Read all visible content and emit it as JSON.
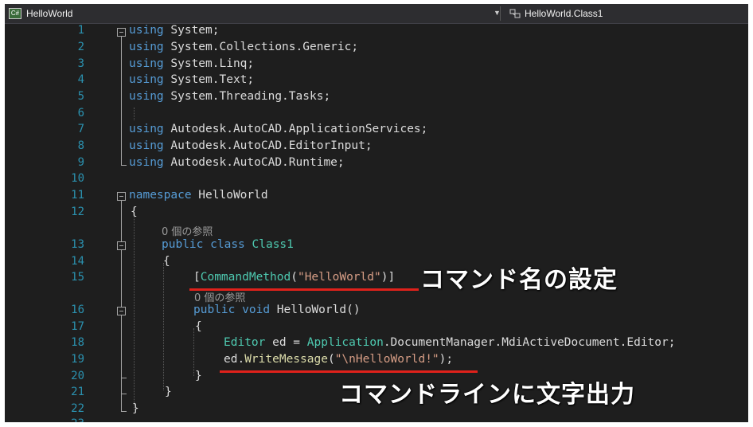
{
  "window": {
    "project_name": "HelloWorld",
    "project_badge": "C#",
    "member_crumb": "HelloWorld.Class1"
  },
  "colors": {
    "keyword": "#569cd6",
    "type": "#4ec9b0",
    "string": "#d69d85",
    "line_number": "#2b91af",
    "annotation_underline": "#e0211b"
  },
  "line_numbers": [
    "1",
    "2",
    "3",
    "4",
    "5",
    "6",
    "7",
    "8",
    "9",
    "10",
    "11",
    "12",
    "",
    "13",
    "14",
    "15",
    "",
    "16",
    "17",
    "18",
    "19",
    "20",
    "21",
    "22",
    "23"
  ],
  "code": {
    "l1": {
      "kw": "using",
      "rest": " System;"
    },
    "l2": {
      "kw": "using",
      "rest": " System.Collections.Generic;"
    },
    "l3": {
      "kw": "using",
      "rest": " System.Linq;"
    },
    "l4": {
      "kw": "using",
      "rest": " System.Text;"
    },
    "l5": {
      "kw": "using",
      "rest": " System.Threading.Tasks;"
    },
    "l7": {
      "kw": "using",
      "rest": " Autodesk.AutoCAD.ApplicationServices;"
    },
    "l8": {
      "kw": "using",
      "rest": " Autodesk.AutoCAD.EditorInput;"
    },
    "l9": {
      "kw": "using",
      "rest": " Autodesk.AutoCAD.Runtime;"
    },
    "l11": {
      "kw": "namespace",
      "rest": " HelloWorld"
    },
    "l12": "{",
    "ref1": "0 個の参照",
    "l13": {
      "kw1": "public",
      "kw2": "class",
      "type": "Class1"
    },
    "l14": "{",
    "l15": {
      "open": "[",
      "type": "CommandMethod",
      "paren_open": "(",
      "str": "\"HelloWorld\"",
      "close": ")]"
    },
    "ref2": "0 個の参照",
    "l16": {
      "kw1": "public",
      "kw2": "void",
      "name": "HelloWorld",
      "parens": "()"
    },
    "l17": "{",
    "l18": {
      "type1": "Editor",
      "rest1": " ed = ",
      "type2": "Application",
      "rest2": ".DocumentManager.MdiActiveDocument.Editor;"
    },
    "l19": {
      "pre": "ed.",
      "method": "WriteMessage",
      "paren_open": "(",
      "str": "\"\\nHelloWorld!\"",
      "close": ");"
    },
    "l20": "}",
    "l21": "}",
    "l22": "}"
  },
  "annotations": {
    "command_name": "コマンド名の設定",
    "output_text": "コマンドラインに文字出力"
  }
}
